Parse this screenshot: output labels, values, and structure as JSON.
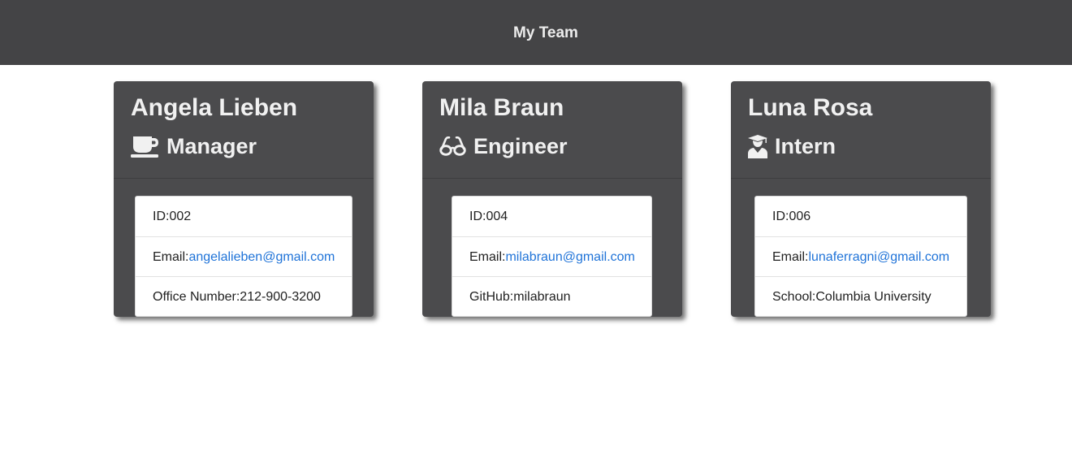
{
  "header": {
    "title": "My Team"
  },
  "employees": [
    {
      "name": "Angela Lieben",
      "role": "Manager",
      "role_icon": "mug-icon",
      "id_label": "ID:",
      "id": "002",
      "email_label": "Email:",
      "email": "angelalieben@gmail.com",
      "extra_label": "Office Number:",
      "extra_value": "212-900-3200"
    },
    {
      "name": "Mila Braun",
      "role": "Engineer",
      "role_icon": "glasses-icon",
      "id_label": "ID:",
      "id": "004",
      "email_label": "Email:",
      "email": "milabraun@gmail.com",
      "extra_label": "GitHub:",
      "extra_value": "milabraun"
    },
    {
      "name": "Luna Rosa",
      "role": "Intern",
      "role_icon": "graduate-icon",
      "id_label": "ID:",
      "id": "006",
      "email_label": "Email:",
      "email": "lunaferragni@gmail.com",
      "extra_label": "School:",
      "extra_value": "Columbia University"
    }
  ],
  "colors": {
    "header_bg": "#444446",
    "card_bg": "#4b4b4d",
    "link": "#1f73d8"
  }
}
